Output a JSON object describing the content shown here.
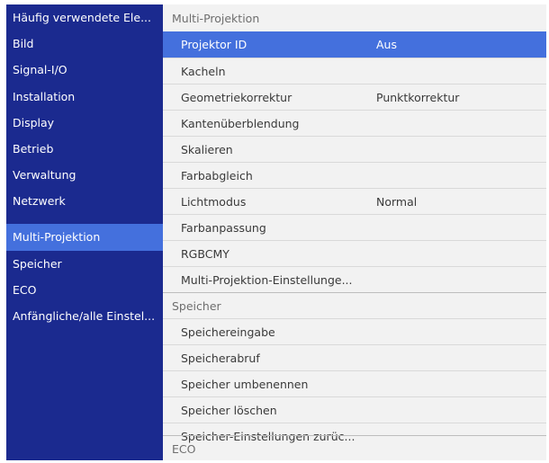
{
  "sidebar": {
    "items": [
      {
        "label": "Häufig verwendete Ele..."
      },
      {
        "label": "Bild"
      },
      {
        "label": "Signal-I/O"
      },
      {
        "label": "Installation"
      },
      {
        "label": "Display"
      },
      {
        "label": "Betrieb"
      },
      {
        "label": "Verwaltung"
      },
      {
        "label": "Netzwerk"
      },
      {
        "label": "Multi-Projektion"
      },
      {
        "label": "Speicher"
      },
      {
        "label": "ECO"
      },
      {
        "label": "Anfängliche/alle Einstel..."
      }
    ],
    "active_label": "Multi-Projektion"
  },
  "content": {
    "group1": {
      "header": "Multi-Projektion",
      "rows": [
        {
          "label": "Projektor ID",
          "value": "Aus"
        },
        {
          "label": "Kacheln",
          "value": ""
        },
        {
          "label": "Geometriekorrektur",
          "value": "Punktkorrektur"
        },
        {
          "label": "Kantenüberblendung",
          "value": ""
        },
        {
          "label": "Skalieren",
          "value": ""
        },
        {
          "label": "Farbabgleich",
          "value": ""
        },
        {
          "label": "Lichtmodus",
          "value": "Normal"
        },
        {
          "label": "Farbanpassung",
          "value": ""
        },
        {
          "label": "RGBCMY",
          "value": ""
        },
        {
          "label": "Multi-Projektion-Einstellunge...",
          "value": ""
        }
      ]
    },
    "group2": {
      "header": "Speicher",
      "rows": [
        {
          "label": "Speichereingabe"
        },
        {
          "label": "Speicherabruf"
        },
        {
          "label": "Speicher umbenennen"
        },
        {
          "label": "Speicher löschen"
        },
        {
          "label": "Speicher-Einstellungen zurüc..."
        }
      ]
    },
    "group3": {
      "header": "ECO"
    }
  },
  "colors": {
    "sidebar_bg": "#1b2a8f",
    "highlight": "#4470dd",
    "content_bg": "#f2f2f2"
  }
}
